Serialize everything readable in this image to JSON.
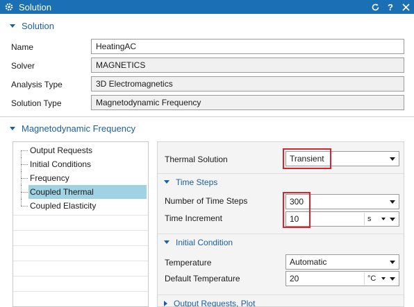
{
  "window": {
    "title": "Solution"
  },
  "solution_section": {
    "header": "Solution",
    "rows": [
      {
        "label": "Name",
        "value": "HeatingAC"
      },
      {
        "label": "Solver",
        "value": "MAGNETICS"
      },
      {
        "label": "Analysis Type",
        "value": "3D Electromagnetics"
      },
      {
        "label": "Solution Type",
        "value": "Magnetodynamic Frequency"
      }
    ]
  },
  "magneto_section": {
    "header": "Magnetodynamic Frequency",
    "tree": [
      {
        "label": "Output Requests",
        "selected": false
      },
      {
        "label": "Initial Conditions",
        "selected": false
      },
      {
        "label": "Frequency",
        "selected": false
      },
      {
        "label": "Coupled Thermal",
        "selected": true
      },
      {
        "label": "Coupled Elasticity",
        "selected": false
      }
    ]
  },
  "panel": {
    "thermal_solution_label": "Thermal Solution",
    "thermal_solution_value": "Transient",
    "time_steps_header": "Time Steps",
    "num_steps_label": "Number of Time Steps",
    "num_steps_value": "300",
    "time_increment_label": "Time Increment",
    "time_increment_value": "10",
    "time_increment_unit": "s",
    "initial_condition_header": "Initial Condition",
    "temperature_label": "Temperature",
    "temperature_value": "Automatic",
    "default_temp_label": "Default Temperature",
    "default_temp_value": "20",
    "default_temp_unit": "°C",
    "output_requests_header": "Output Requests, Plot"
  },
  "colors": {
    "titlebar": "#1a6fb5",
    "accent": "#1a5fa3",
    "highlight": "#d8232a",
    "selection": "#9fd3e3"
  }
}
